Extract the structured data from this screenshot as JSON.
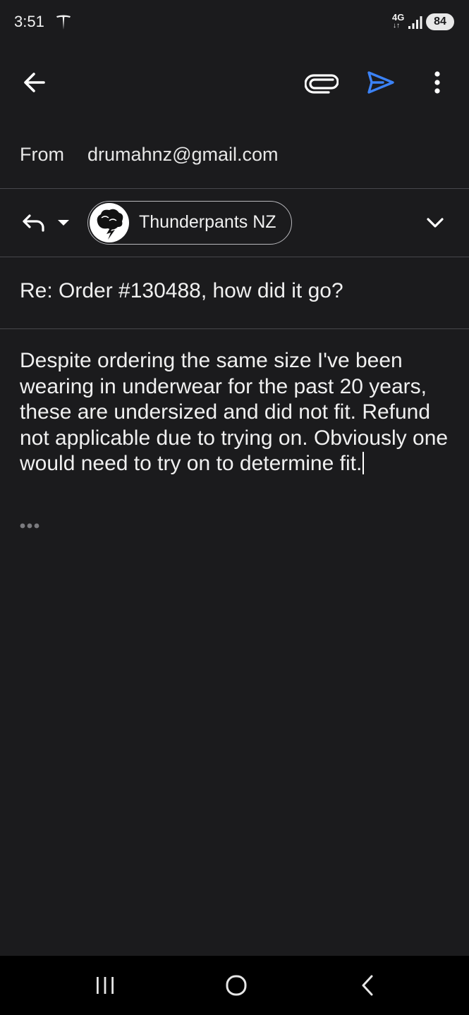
{
  "status_bar": {
    "time": "3:51",
    "network": "4G",
    "network_arrows": "↓↑",
    "battery": "84",
    "icons": [
      "tesla-icon",
      "signal-bars-icon"
    ]
  },
  "app_bar": {
    "icons": [
      "arrow-back-icon",
      "attachment-icon",
      "send-icon",
      "more-vert-icon"
    ],
    "send_color": "#3b82f6"
  },
  "compose": {
    "from_label": "From",
    "from_value": "drumahnz@gmail.com",
    "recipient": {
      "name": "Thunderpants NZ",
      "avatar_icon": "thunderpants-logo"
    },
    "subject": "Re: Order #130488, how did it go?",
    "body": "Despite ordering the same size I've been wearing in underwear for the past 20 years, these are undersized and did not fit. Refund not applicable due to trying on. Obviously one would need to try on to determine fit."
  },
  "colors": {
    "background": "#1b1b1d",
    "text": "#f0f0f0",
    "divider": "#48484c",
    "accent": "#3b82f6"
  }
}
